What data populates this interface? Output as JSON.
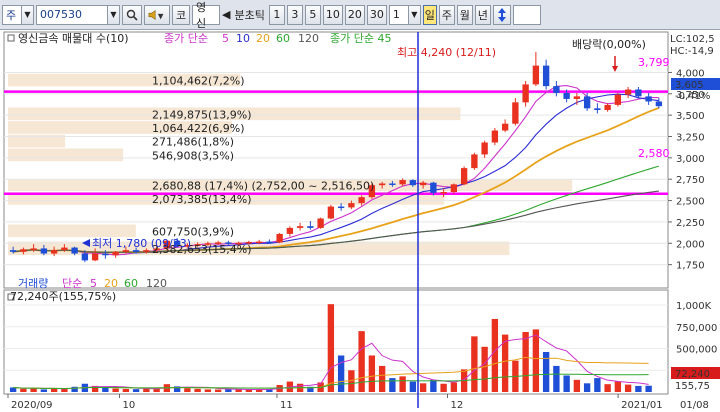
{
  "toolbar": {
    "mode": "주",
    "code": "007530",
    "code_button": "코",
    "name": "영신",
    "compare": "분초틱",
    "periods": [
      "1",
      "3",
      "5",
      "10",
      "20",
      "30"
    ],
    "count": "1",
    "day": "일",
    "week": "주",
    "month": "월",
    "year": "년"
  },
  "legend": {
    "title": "영신금속 매물대 수(10)",
    "ma_label": "종가 단순",
    "ma_periods": [
      "5",
      "10",
      "20",
      "60",
      "120"
    ],
    "ma2_label": "종가 단순 45",
    "volume_label": "거래량",
    "vol_ma_label": "단순",
    "vol_ma_periods": [
      "5",
      "20",
      "60",
      "120"
    ],
    "volume_info": "72,240주(155,75%)"
  },
  "annotations": {
    "max_label": "최고 4,240 (12/11)",
    "min_label": "최저 1,780 (09/23)",
    "dividend": "배당락(0,00%)",
    "last_value": "3,799",
    "level_2580": "2,580",
    "lc": "LC:102,5",
    "hc": "HC:-14,9",
    "current_price": "3,605",
    "current_change": "-0,41%",
    "vol_current": "72,240",
    "vol_current_pct": "155,75",
    "channel_label": "2,680,88 (17,4%) (2,752,00 ~ 2,516,50)"
  },
  "colors": {
    "accent": "#ff00ff",
    "up": "#e8311f",
    "down": "#1f4fd6",
    "ma5": "#cc33cc",
    "ma10": "#2c2cd6",
    "ma20": "#e8a21a",
    "ma60": "#2ea82e",
    "ma120": "#555555",
    "band": "#f5e3cc"
  },
  "chart_data": {
    "type": "candlestick",
    "y_axis": {
      "range": [
        1500,
        4450
      ],
      "ticks": [
        "4,000",
        "3,750",
        "3,500",
        "3,250",
        "3,000",
        "2,750",
        "2,500",
        "2,250",
        "2,000",
        "1,750"
      ]
    },
    "volume_axis": {
      "range": [
        0,
        1150000
      ],
      "ticks": [
        "1,000K",
        "750,000",
        "500,000",
        "250,000"
      ]
    },
    "x_axis": {
      "labels": [
        "2020/09",
        "10",
        "11",
        "12",
        "2021/01",
        "01/08"
      ]
    },
    "volume_profile": [
      {
        "label": "1,104,462(7,2%)",
        "price_low": 3825,
        "price_high": 3985,
        "value": 1104462
      },
      {
        "label": "2,149,875(13,9%)",
        "price_low": 3430,
        "price_high": 3590,
        "value": 2149875
      },
      {
        "label": "1,064,422(6,9%)",
        "price_low": 3270,
        "price_high": 3430,
        "value": 1064422
      },
      {
        "label": "271,486(1,8%)",
        "price_low": 3110,
        "price_high": 3270,
        "value": 271486
      },
      {
        "label": "546,908(3,5%)",
        "price_low": 2950,
        "price_high": 3110,
        "value": 546908
      },
      {
        "label": "2,680,88 (17,4%) (2,752,00 ~ 2,516,50)",
        "price_low": 2600,
        "price_high": 2752,
        "value": 2680880
      },
      {
        "label": "2,073,385(13,4%)",
        "price_low": 2440,
        "price_high": 2600,
        "value": 2073385
      },
      {
        "label": "607,750(3,9%)",
        "price_low": 2060,
        "price_high": 2220,
        "value": 607750
      },
      {
        "label": "2,382,653(15,4%)",
        "price_low": 1850,
        "price_high": 2020,
        "value": 2382653
      }
    ],
    "horizontal_lines": [
      3775,
      2580
    ],
    "candles": [
      {
        "o": 1920,
        "h": 1960,
        "l": 1880,
        "c": 1900
      },
      {
        "o": 1900,
        "h": 1950,
        "l": 1870,
        "c": 1930
      },
      {
        "o": 1930,
        "h": 1990,
        "l": 1900,
        "c": 1940
      },
      {
        "o": 1940,
        "h": 1980,
        "l": 1860,
        "c": 1880
      },
      {
        "o": 1880,
        "h": 1960,
        "l": 1850,
        "c": 1920
      },
      {
        "o": 1920,
        "h": 1990,
        "l": 1900,
        "c": 1950
      },
      {
        "o": 1950,
        "h": 1960,
        "l": 1860,
        "c": 1880
      },
      {
        "o": 1880,
        "h": 1920,
        "l": 1780,
        "c": 1800
      },
      {
        "o": 1800,
        "h": 1940,
        "l": 1790,
        "c": 1880
      },
      {
        "o": 1880,
        "h": 1920,
        "l": 1820,
        "c": 1860
      },
      {
        "o": 1860,
        "h": 1910,
        "l": 1830,
        "c": 1900
      },
      {
        "o": 1900,
        "h": 1960,
        "l": 1880,
        "c": 1920
      },
      {
        "o": 1920,
        "h": 1950,
        "l": 1880,
        "c": 1900
      },
      {
        "o": 1900,
        "h": 1940,
        "l": 1880,
        "c": 1920
      },
      {
        "o": 1920,
        "h": 1960,
        "l": 1890,
        "c": 1940
      },
      {
        "o": 1940,
        "h": 2040,
        "l": 1920,
        "c": 2030
      },
      {
        "o": 2030,
        "h": 2060,
        "l": 1950,
        "c": 1970
      },
      {
        "o": 1970,
        "h": 2000,
        "l": 1950,
        "c": 1980
      },
      {
        "o": 1980,
        "h": 2010,
        "l": 1960,
        "c": 1990
      },
      {
        "o": 1990,
        "h": 2020,
        "l": 1970,
        "c": 2000
      },
      {
        "o": 2000,
        "h": 2030,
        "l": 1980,
        "c": 2010
      },
      {
        "o": 2010,
        "h": 2030,
        "l": 1980,
        "c": 1995
      },
      {
        "o": 1995,
        "h": 2020,
        "l": 1970,
        "c": 2005
      },
      {
        "o": 2005,
        "h": 2030,
        "l": 1985,
        "c": 2015
      },
      {
        "o": 2015,
        "h": 2040,
        "l": 1990,
        "c": 2020
      },
      {
        "o": 2020,
        "h": 2045,
        "l": 1995,
        "c": 2010
      },
      {
        "o": 2010,
        "h": 2120,
        "l": 2000,
        "c": 2110
      },
      {
        "o": 2110,
        "h": 2200,
        "l": 2080,
        "c": 2180
      },
      {
        "o": 2180,
        "h": 2240,
        "l": 2150,
        "c": 2200
      },
      {
        "o": 2200,
        "h": 2260,
        "l": 2160,
        "c": 2180
      },
      {
        "o": 2180,
        "h": 2300,
        "l": 2170,
        "c": 2290
      },
      {
        "o": 2290,
        "h": 2450,
        "l": 2280,
        "c": 2430
      },
      {
        "o": 2430,
        "h": 2470,
        "l": 2380,
        "c": 2420
      },
      {
        "o": 2420,
        "h": 2500,
        "l": 2400,
        "c": 2470
      },
      {
        "o": 2470,
        "h": 2560,
        "l": 2440,
        "c": 2540
      },
      {
        "o": 2540,
        "h": 2700,
        "l": 2520,
        "c": 2680
      },
      {
        "o": 2680,
        "h": 2720,
        "l": 2640,
        "c": 2700
      },
      {
        "o": 2700,
        "h": 2730,
        "l": 2660,
        "c": 2690
      },
      {
        "o": 2690,
        "h": 2760,
        "l": 2670,
        "c": 2740
      },
      {
        "o": 2740,
        "h": 2750,
        "l": 2660,
        "c": 2680
      },
      {
        "o": 2680,
        "h": 2730,
        "l": 2640,
        "c": 2710
      },
      {
        "o": 2710,
        "h": 2720,
        "l": 2560,
        "c": 2590
      },
      {
        "o": 2590,
        "h": 2640,
        "l": 2540,
        "c": 2600
      },
      {
        "o": 2600,
        "h": 2700,
        "l": 2580,
        "c": 2690
      },
      {
        "o": 2690,
        "h": 2900,
        "l": 2680,
        "c": 2880
      },
      {
        "o": 2880,
        "h": 3060,
        "l": 2860,
        "c": 3040
      },
      {
        "o": 3040,
        "h": 3200,
        "l": 3000,
        "c": 3180
      },
      {
        "o": 3180,
        "h": 3350,
        "l": 3150,
        "c": 3320
      },
      {
        "o": 3320,
        "h": 3450,
        "l": 3300,
        "c": 3400
      },
      {
        "o": 3400,
        "h": 3700,
        "l": 3380,
        "c": 3650
      },
      {
        "o": 3650,
        "h": 3900,
        "l": 3600,
        "c": 3860
      },
      {
        "o": 3860,
        "h": 4240,
        "l": 3840,
        "c": 4080
      },
      {
        "o": 4080,
        "h": 4150,
        "l": 3800,
        "c": 3840
      },
      {
        "o": 3840,
        "h": 3900,
        "l": 3720,
        "c": 3760
      },
      {
        "o": 3760,
        "h": 3800,
        "l": 3650,
        "c": 3690
      },
      {
        "o": 3690,
        "h": 3760,
        "l": 3620,
        "c": 3720
      },
      {
        "o": 3720,
        "h": 3760,
        "l": 3550,
        "c": 3580
      },
      {
        "o": 3580,
        "h": 3640,
        "l": 3520,
        "c": 3560
      },
      {
        "o": 3560,
        "h": 3640,
        "l": 3540,
        "c": 3620
      },
      {
        "o": 3620,
        "h": 3760,
        "l": 3600,
        "c": 3740
      },
      {
        "o": 3740,
        "h": 3830,
        "l": 3700,
        "c": 3800
      },
      {
        "o": 3800,
        "h": 3830,
        "l": 3700,
        "c": 3720
      },
      {
        "o": 3720,
        "h": 3760,
        "l": 3620,
        "c": 3660
      },
      {
        "o": 3660,
        "h": 3700,
        "l": 3580,
        "c": 3605
      }
    ],
    "volumes": [
      52000,
      38000,
      45000,
      30000,
      41000,
      36000,
      60000,
      95000,
      70000,
      48000,
      40000,
      35000,
      33000,
      42000,
      38000,
      90000,
      65000,
      44000,
      36000,
      30000,
      28000,
      32000,
      30000,
      27000,
      25000,
      35000,
      80000,
      120000,
      95000,
      60000,
      110000,
      1010000,
      420000,
      250000,
      700000,
      420000,
      300000,
      160000,
      180000,
      120000,
      100000,
      140000,
      95000,
      110000,
      260000,
      640000,
      520000,
      840000,
      660000,
      360000,
      690000,
      720000,
      460000,
      300000,
      190000,
      140000,
      100000,
      160000,
      90000,
      120000,
      85000,
      70000,
      72240
    ]
  }
}
